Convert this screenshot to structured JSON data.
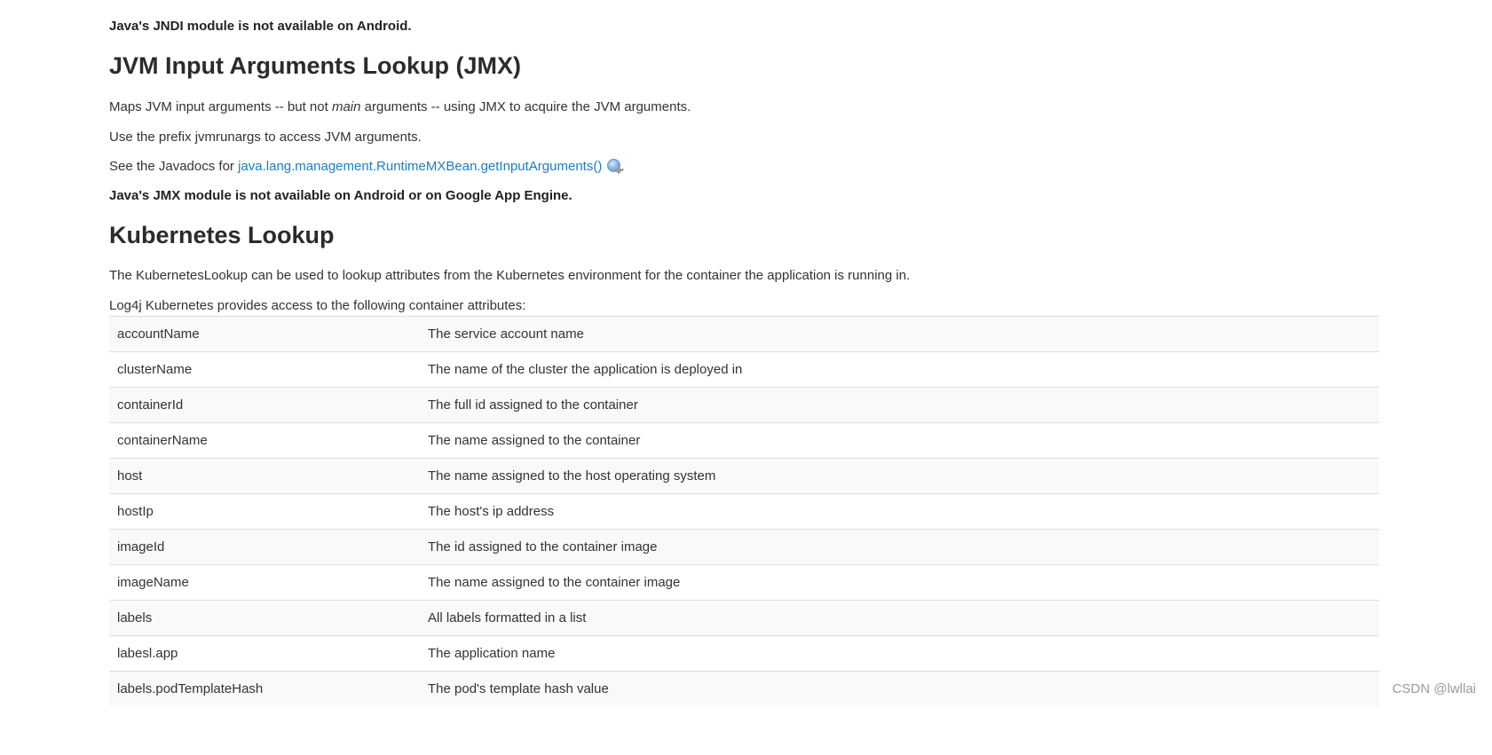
{
  "sections": {
    "jndi_note": "Java's JNDI module is not available on Android.",
    "jvm": {
      "heading": "JVM Input Arguments Lookup (JMX)",
      "p1_before": "Maps JVM input arguments -- but not ",
      "p1_italic": "main",
      "p1_after": " arguments -- using JMX to acquire the JVM arguments.",
      "p2": "Use the prefix jvmrunargs to access JVM arguments.",
      "p3_before": "See the Javadocs for ",
      "p3_link": "java.lang.management.RuntimeMXBean.getInputArguments()",
      "p3_after": ".",
      "link_icon": "external-link-globe-icon",
      "jmx_note": "Java's JMX module is not available on Android or on Google App Engine."
    },
    "kubernetes": {
      "heading": "Kubernetes Lookup",
      "p1": "The KubernetesLookup can be used to lookup attributes from the Kubernetes environment for the container the application is running in.",
      "p2": "Log4j Kubernetes provides access to the following container attributes:",
      "attributes": [
        {
          "name": "accountName",
          "description": "The service account name"
        },
        {
          "name": "clusterName",
          "description": "The name of the cluster the application is deployed in"
        },
        {
          "name": "containerId",
          "description": "The full id assigned to the container"
        },
        {
          "name": "containerName",
          "description": "The name assigned to the container"
        },
        {
          "name": "host",
          "description": "The name assigned to the host operating system"
        },
        {
          "name": "hostIp",
          "description": "The host's ip address"
        },
        {
          "name": "imageId",
          "description": "The id assigned to the container image"
        },
        {
          "name": "imageName",
          "description": "The name assigned to the container image"
        },
        {
          "name": "labels",
          "description": "All labels formatted in a list"
        },
        {
          "name": "labesl.app",
          "description": "The application name"
        },
        {
          "name": "labels.podTemplateHash",
          "description": "The pod's template hash value"
        }
      ]
    }
  },
  "watermark": "CSDN @lwllai",
  "colors": {
    "link": "#1f7dc2",
    "text": "#333333",
    "row_stripe": "#f9f9f9",
    "row_border": "#dddddd"
  }
}
